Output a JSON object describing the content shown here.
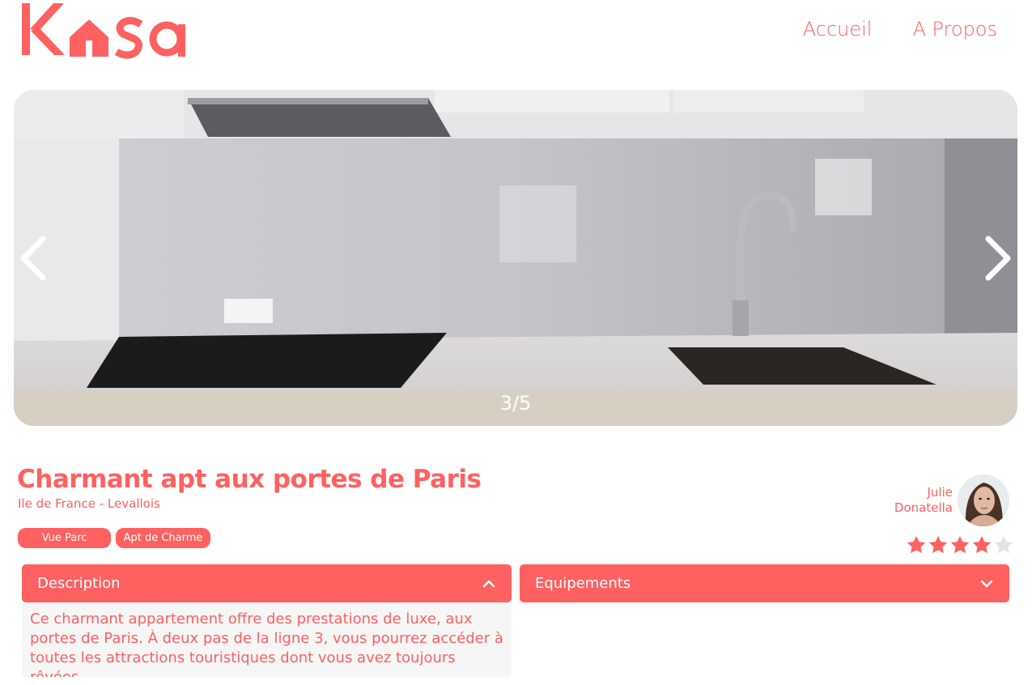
{
  "brand": {
    "logo_text": "Kasa",
    "accent_color": "#FF6060"
  },
  "nav": {
    "items": [
      {
        "label": "Accueil"
      },
      {
        "label": "A Propos"
      }
    ]
  },
  "carousel": {
    "current": 3,
    "total": 5,
    "counter_text": "3/5",
    "prev_icon": "chevron-left-icon",
    "next_icon": "chevron-right-icon"
  },
  "listing": {
    "title": "Charmant apt aux portes de Paris",
    "location": "Ile de France - Levallois",
    "tags": [
      "Vue Parc",
      "Apt de Charme"
    ]
  },
  "host": {
    "first_name": "Julie",
    "last_name": "Donatella",
    "avatar_icon": "avatar-photo"
  },
  "rating": {
    "value": 4,
    "max": 5,
    "filled_color": "#FF6060",
    "empty_color": "#E3E3E3"
  },
  "collapses": {
    "description": {
      "title": "Description",
      "expanded": true,
      "icon": "chevron-up-icon",
      "body": "Ce charmant appartement offre des prestations de luxe, aux portes de Paris. À deux pas de la ligne 3, vous pourrez accéder à toutes les attractions touristiques dont vous avez toujours rêvées."
    },
    "equipements": {
      "title": "Equipements",
      "expanded": false,
      "icon": "chevron-down-icon"
    }
  }
}
